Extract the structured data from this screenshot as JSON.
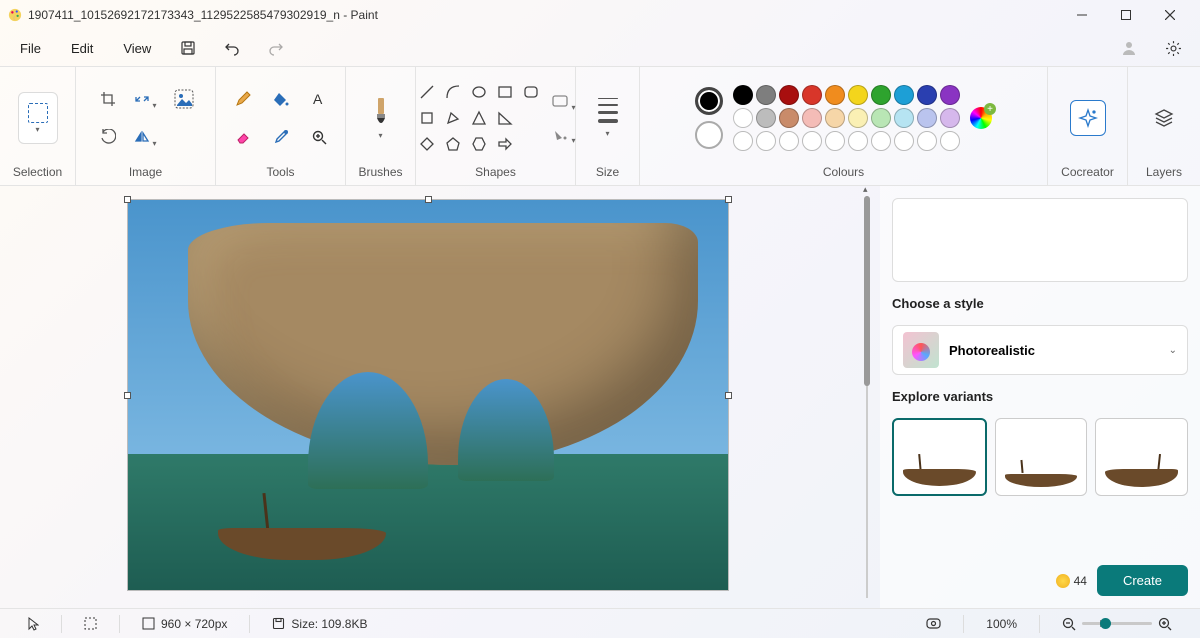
{
  "title": "1907411_10152692172173343_1129522585479302919_n - Paint",
  "menu": {
    "file": "File",
    "edit": "Edit",
    "view": "View"
  },
  "ribbon": {
    "selection": "Selection",
    "image": "Image",
    "tools": "Tools",
    "brushes": "Brushes",
    "shapes": "Shapes",
    "size": "Size",
    "colours": "Colours",
    "cocreator": "Cocreator",
    "layers": "Layers"
  },
  "palette_row1": [
    "#000000",
    "#7e7e7e",
    "#a80f0f",
    "#d8362a",
    "#f08c1e",
    "#f3d51c",
    "#2ea32e",
    "#1d9fd6",
    "#2a3fb0",
    "#8a34c2"
  ],
  "palette_row2": [
    "#ffffff",
    "#bcbcbc",
    "#c98b6a",
    "#f4bcb7",
    "#f6d6a8",
    "#faf0b4",
    "#b9e6b5",
    "#b6e4f2",
    "#bac4ee",
    "#d6b8ec"
  ],
  "cocreator_panel": {
    "choose_style": "Choose a style",
    "style_name": "Photorealistic",
    "explore_variants": "Explore variants",
    "credits": "44",
    "create": "Create"
  },
  "status": {
    "dimensions": "960 × 720px",
    "size_label": "Size: 109.8KB",
    "zoom": "100%"
  }
}
